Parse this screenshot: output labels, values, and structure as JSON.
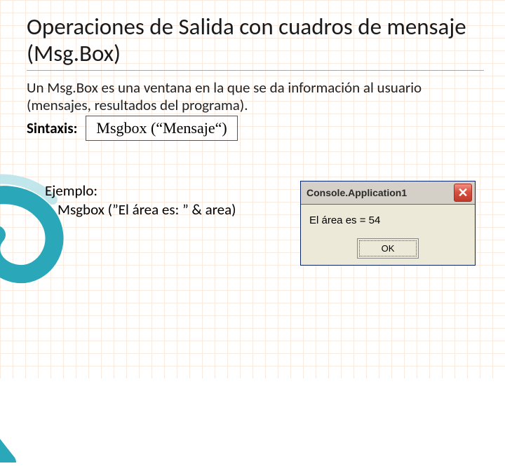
{
  "slide": {
    "title": "Operaciones de Salida con cuadros de mensaje (Msg.Box)",
    "intro": "Un Msg.Box es una ventana en la que se da  información al usuario (mensajes, resultados del programa).",
    "sintaxis_label": "Sintaxis:",
    "syntax_code": "Msgbox (“Mensaje“)",
    "example_label": "Ejemplo:",
    "example_code": "Msgbox (”El área es: ” & area)"
  },
  "msgbox": {
    "title": "Console.Application1",
    "body_text": "El área es = 54",
    "ok_label": "OK",
    "close_glyph": "✕"
  }
}
